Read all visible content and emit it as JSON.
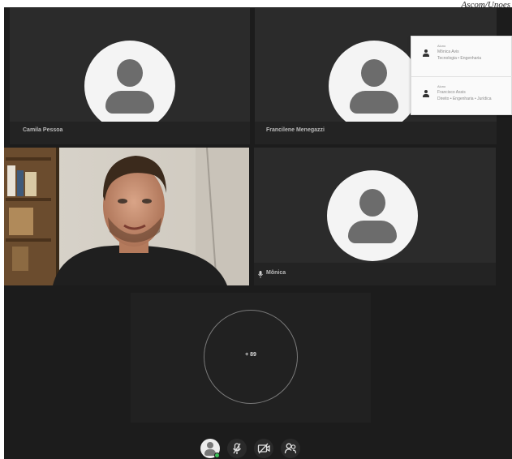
{
  "credit": "Ascom/Unoes",
  "participants": [
    {
      "name": "Camila Pessoa"
    },
    {
      "name": "Francilene Menegazzi"
    },
    {
      "name": "Mônica"
    }
  ],
  "participant_list": [
    {
      "role": "Aluno",
      "name": "Mônica Avis",
      "detail": "Tecnologia • Engenharia"
    },
    {
      "role": "Aluno",
      "name": "Francisco Assis",
      "detail": "Direito • Engenharia • Jurídica"
    }
  ],
  "overflow": {
    "label": "+ 89"
  },
  "colors": {
    "background": "#1c1c1c",
    "tile": "#2b2b2b",
    "status_online": "#3cc35a"
  },
  "controls": [
    "user-status",
    "microphone-off",
    "camera-off",
    "participants"
  ]
}
